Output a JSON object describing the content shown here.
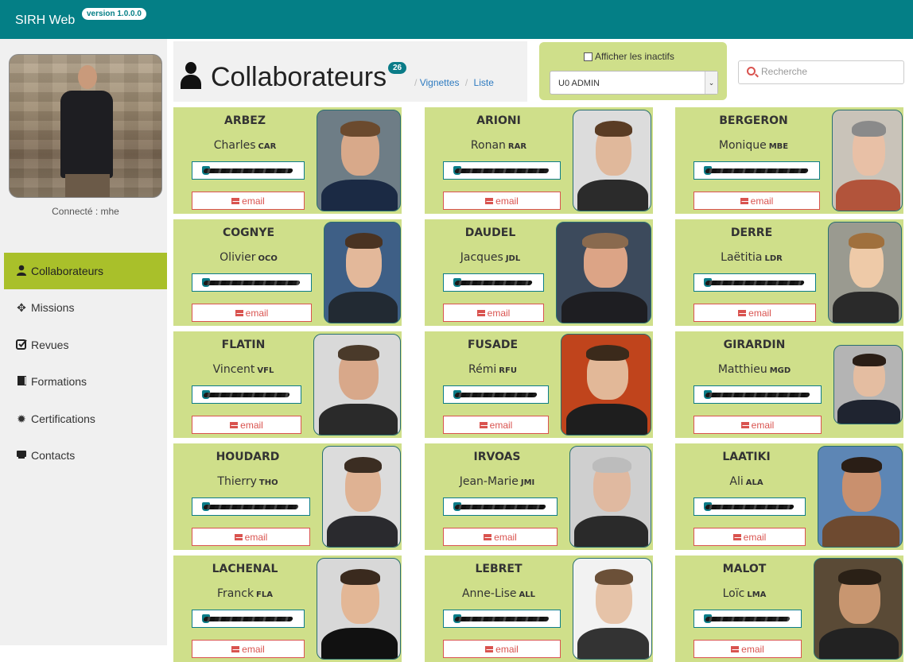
{
  "app": {
    "brand": "SIRH Web",
    "version": "version 1.0.0.0"
  },
  "sidebar": {
    "connected": "Connecté : mhe",
    "items": [
      {
        "label": "Collaborateurs",
        "icon": "user-icon",
        "active": true
      },
      {
        "label": "Missions",
        "icon": "move-arrows-icon",
        "active": false
      },
      {
        "label": "Revues",
        "icon": "check-square-icon",
        "active": false
      },
      {
        "label": "Formations",
        "icon": "book-icon",
        "active": false
      },
      {
        "label": "Certifications",
        "icon": "certificate-icon",
        "active": false
      },
      {
        "label": "Contacts",
        "icon": "contact-card-icon",
        "active": false
      }
    ]
  },
  "header": {
    "title": "Collaborateurs",
    "count": "26",
    "breadcrumb": {
      "sep": "/",
      "vignettes": "Vignettes",
      "liste": "Liste"
    }
  },
  "filter": {
    "show_inactive_label": "Afficher les inactifs",
    "select_value": "U0 ADMIN"
  },
  "search": {
    "placeholder": "Recherche"
  },
  "email_label": "email",
  "cards": [
    {
      "lastname": "ARBEZ",
      "firstname": "Charles",
      "code": "CAR"
    },
    {
      "lastname": "ARIONI",
      "firstname": "Ronan",
      "code": "RAR"
    },
    {
      "lastname": "BERGERON",
      "firstname": "Monique",
      "code": "MBE"
    },
    {
      "lastname": "COGNYE",
      "firstname": "Olivier",
      "code": "OCO"
    },
    {
      "lastname": "DAUDEL",
      "firstname": "Jacques",
      "code": "JDL"
    },
    {
      "lastname": "DERRE",
      "firstname": "Laëtitia",
      "code": "LDR"
    },
    {
      "lastname": "FLATIN",
      "firstname": "Vincent",
      "code": "VFL"
    },
    {
      "lastname": "FUSADE",
      "firstname": "Rémi",
      "code": "RFU"
    },
    {
      "lastname": "GIRARDIN",
      "firstname": "Matthieu",
      "code": "MGD"
    },
    {
      "lastname": "HOUDARD",
      "firstname": "Thierry",
      "code": "THO"
    },
    {
      "lastname": "IRVOAS",
      "firstname": "Jean-Marie",
      "code": "JMI"
    },
    {
      "lastname": "LAATIKI",
      "firstname": "Ali",
      "code": "ALA"
    },
    {
      "lastname": "LACHENAL",
      "firstname": "Franck",
      "code": "FLA"
    },
    {
      "lastname": "LEBRET",
      "firstname": "Anne-Lise",
      "code": "ALL"
    },
    {
      "lastname": "MALOT",
      "firstname": "Loïc",
      "code": "LMA"
    }
  ],
  "colors": {
    "topbar": "#047f86",
    "accent": "#a9c02a",
    "card": "#cfdf8a",
    "danger": "#d9534f"
  }
}
